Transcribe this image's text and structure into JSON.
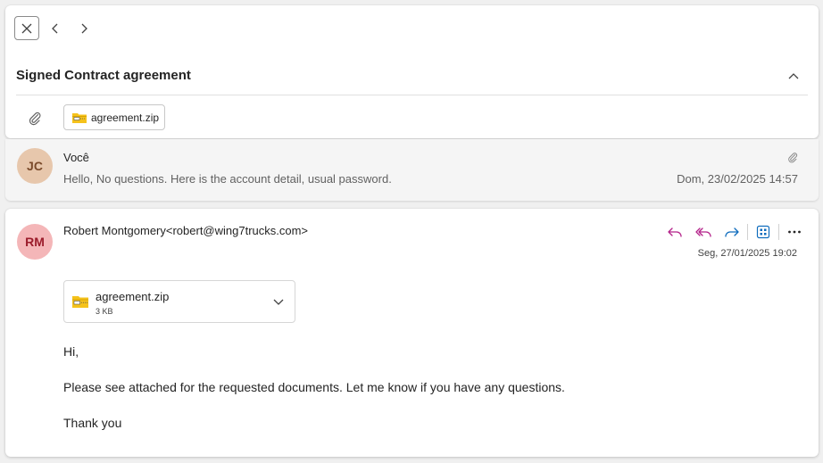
{
  "header": {
    "subject": "Signed Contract agreement",
    "attachment_chip": "agreement.zip"
  },
  "messages": [
    {
      "avatar_initials": "JC",
      "sender": "Você",
      "preview": "Hello, No questions. Here is the account detail, usual password.",
      "date": "Dom, 23/02/2025 14:57",
      "avatar_color": "#e7c7ac"
    },
    {
      "avatar_initials": "RM",
      "sender": "Robert Montgomery<robert@wing7trucks.com>",
      "date": "Seg, 27/01/2025 19:02",
      "avatar_color": "#f4b6b8",
      "attachment": {
        "name": "agreement.zip",
        "size": "3 KB"
      },
      "body": {
        "greeting": "Hi,",
        "text": "Please see attached for the requested documents. Let me know if you have any questions.",
        "closing": "Thank you"
      }
    }
  ],
  "icons": {
    "close": "close-icon",
    "prev": "chevron-left-icon",
    "next": "chevron-right-icon",
    "collapse": "chevron-up-icon",
    "attachment": "paperclip-icon",
    "zip": "zip-folder-icon",
    "reply": "reply-icon",
    "reply_all": "reply-all-icon",
    "forward": "forward-icon",
    "apps": "apps-icon",
    "more": "more-icon"
  },
  "colors": {
    "reply_accent": "#b4238a",
    "forward_accent": "#0f6cbd",
    "zip_folder": "#f5c21b"
  }
}
